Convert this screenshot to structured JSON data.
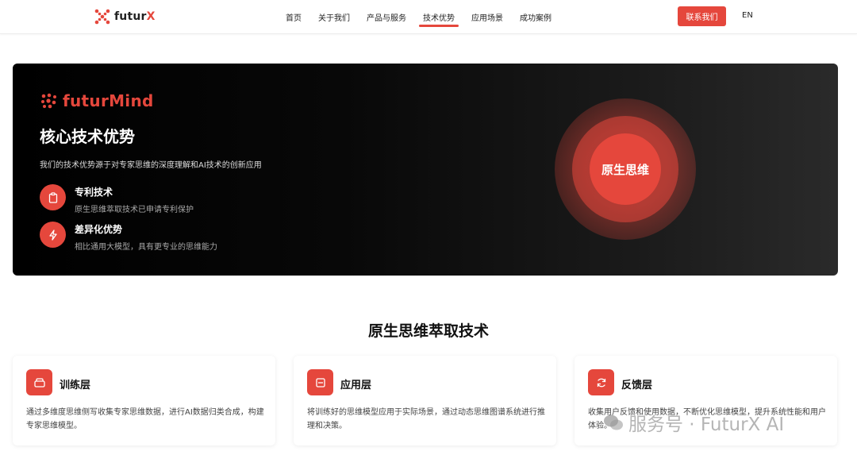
{
  "nav": {
    "brand": {
      "prefix": "futur",
      "suffix": "X"
    },
    "links": [
      "首页",
      "关于我们",
      "产品与服务",
      "技术优势",
      "应用场景",
      "成功案例"
    ],
    "active_index": 3,
    "contact_label": "联系我们",
    "lang_label": "EN"
  },
  "hero": {
    "brand": "futurMind",
    "title": "核心技术优势",
    "description": "我们的技术优势源于对专家思维的深度理解和AI技术的创新应用",
    "features": [
      {
        "title": "专利技术",
        "subtitle": "原生思维萃取技术已申请专利保护",
        "icon": "clipboard-icon"
      },
      {
        "title": "差异化优势",
        "subtitle": "相比通用大模型，具有更专业的思维能力",
        "icon": "lightning-icon"
      }
    ],
    "orb_label": "原生思维"
  },
  "section": {
    "title": "原生思维萃取技术",
    "cards": [
      {
        "title": "训练层",
        "description": "通过多维度思维侧写收集专家思维数据，进行AI数据归类合成，构建专家思维模型。",
        "icon": "layers-icon"
      },
      {
        "title": "应用层",
        "description": "将训练好的思维模型应用于实际场景，通过动态思维图谱系统进行推理和决策。",
        "icon": "panel-icon"
      },
      {
        "title": "反馈层",
        "description": "收集用户反馈和使用数据，不断优化思维模型，提升系统性能和用户体验。",
        "icon": "refresh-icon"
      }
    ]
  },
  "watermark": "服务号 · FuturX AI",
  "colors": {
    "accent": "#e5473c",
    "dark": "#000000"
  }
}
